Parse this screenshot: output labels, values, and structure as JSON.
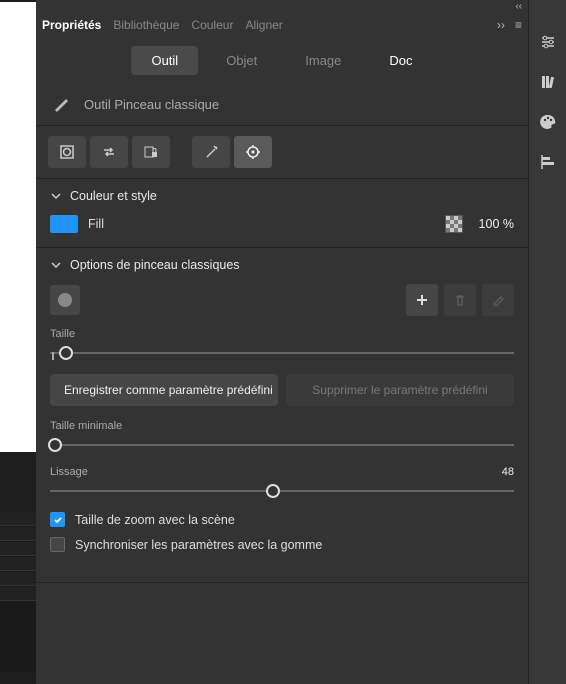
{
  "collapse": "‹‹",
  "panel_tabs": {
    "items": [
      {
        "label": "Propriétés",
        "active": true
      },
      {
        "label": "Bibliothèque",
        "active": false
      },
      {
        "label": "Couleur",
        "active": false
      },
      {
        "label": "Aligner",
        "active": false
      }
    ],
    "expand": "››",
    "menu": "≡"
  },
  "subtabs": {
    "outil": "Outil",
    "objet": "Objet",
    "image": "Image",
    "doc": "Doc"
  },
  "tool": {
    "name": "Outil Pinceau classique"
  },
  "toolbar_icons": {
    "object_drawing": "object-drawing-icon",
    "swap": "swap-icon",
    "lock": "lock-fill-icon",
    "magic": "paint-behind-icon",
    "target": "paint-inside-icon"
  },
  "sections": {
    "color_style": {
      "title": "Couleur et style",
      "fill_label": "Fill",
      "fill_color": "#2094fa",
      "opacity": "100 %"
    },
    "brush_options": {
      "title": "Options de pinceau classiques",
      "size_label": "Taille",
      "size_value": "",
      "save_preset": "Enregistrer comme paramètre prédéfini",
      "delete_preset": "Supprimer le paramètre prédéfini",
      "min_size_label": "Taille minimale",
      "min_size_value": "",
      "smoothing_label": "Lissage",
      "smoothing_value": "48",
      "zoom_with_stage": "Taille de zoom avec la scène",
      "sync_eraser": "Synchroniser les paramètres avec la gomme",
      "zoom_checked": true,
      "sync_checked": false
    }
  },
  "right_rail": {
    "icons": [
      "prefs-icon",
      "library-icon",
      "palette-icon",
      "align-icon"
    ]
  }
}
